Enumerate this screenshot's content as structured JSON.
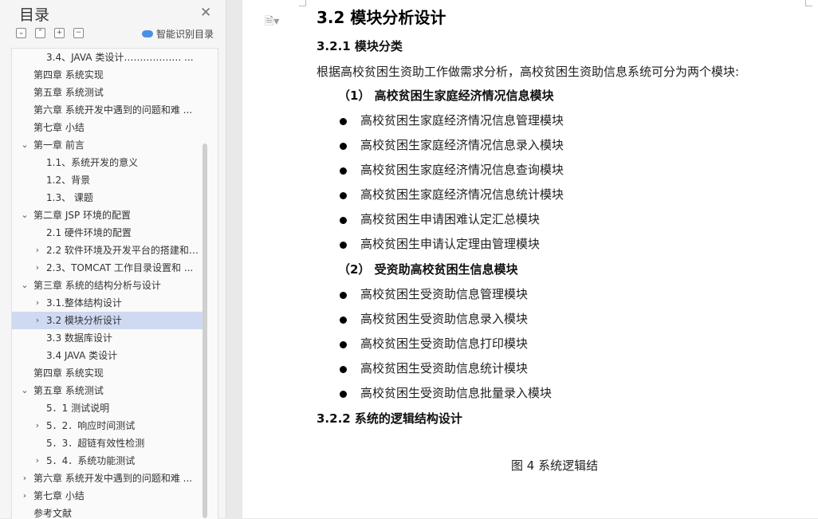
{
  "sidebar": {
    "title": "目录",
    "close_icon": "close-icon",
    "toolbar": [
      "collapse-all-icon",
      "expand-all-icon",
      "add-icon",
      "remove-icon"
    ],
    "smart_toc_label": "智能识别目录",
    "items": [
      {
        "label": "3.4、JAVA 类设计……………… ...",
        "level": 2,
        "chevron": ""
      },
      {
        "label": "第四章  系统实现",
        "level": 1,
        "chevron": ""
      },
      {
        "label": "第五章  系统测试",
        "level": 1,
        "chevron": ""
      },
      {
        "label": "第六章  系统开发中遇到的问题和难 ...",
        "level": 1,
        "chevron": ""
      },
      {
        "label": "第七章  小结",
        "level": 1,
        "chevron": ""
      },
      {
        "label": "第一章    前言",
        "level": 1,
        "chevron": "down"
      },
      {
        "label": "1.1、系统开发的意义",
        "level": 2,
        "chevron": ""
      },
      {
        "label": "1.2、背景",
        "level": 2,
        "chevron": ""
      },
      {
        "label": "1.3、  课题",
        "level": 2,
        "chevron": ""
      },
      {
        "label": "第二章    JSP 环境的配置",
        "level": 1,
        "chevron": "down"
      },
      {
        "label": "2.1 硬件环境的配置",
        "level": 2,
        "chevron": ""
      },
      {
        "label": "2.2 软件环境及开发平台的搭建和 ...",
        "level": 2,
        "chevron": "right"
      },
      {
        "label": "2.3、TOMCAT 工作目录设置和 ...",
        "level": 2,
        "chevron": "right"
      },
      {
        "label": "第三章  系统的结构分析与设计",
        "level": 1,
        "chevron": "down"
      },
      {
        "label": "3.1.整体结构设计",
        "level": 2,
        "chevron": "right"
      },
      {
        "label": "3.2  模块分析设计",
        "level": 2,
        "chevron": "right",
        "selected": true
      },
      {
        "label": "3.3 数据库设计",
        "level": 2,
        "chevron": ""
      },
      {
        "label": "3.4 JAVA 类设计",
        "level": 2,
        "chevron": ""
      },
      {
        "label": "第四章  系统实现",
        "level": 1,
        "chevron": ""
      },
      {
        "label": "第五章    系统测试",
        "level": 1,
        "chevron": "down"
      },
      {
        "label": "5．1  测试说明",
        "level": 2,
        "chevron": ""
      },
      {
        "label": "5．2．响应时间测试",
        "level": 2,
        "chevron": "right"
      },
      {
        "label": "5．3．超链有效性检测",
        "level": 2,
        "chevron": ""
      },
      {
        "label": "5．4．系统功能测试",
        "level": 2,
        "chevron": "right"
      },
      {
        "label": "第六章  系统开发中遇到的问题和难 ...",
        "level": 1,
        "chevron": "right"
      },
      {
        "label": "第七章  小结",
        "level": 1,
        "chevron": "right"
      },
      {
        "label": "参考文献",
        "level": 1,
        "chevron": ""
      }
    ]
  },
  "document": {
    "section_title": "3.2  模块分析设计",
    "subsection_1": "3.2.1 模块分类",
    "intro": "根据高校贫困生资助工作做需求分析，高校贫困生资助信息系统可分为两个模块:",
    "group_1_title": "（1）  高校贫困生家庭经济情况信息模块",
    "group_1_items": [
      "高校贫困生家庭经济情况信息管理模块",
      "高校贫困生家庭经济情况信息录入模块",
      "高校贫困生家庭经济情况信息查询模块",
      "高校贫困生家庭经济情况信息统计模块",
      "高校贫困生申请困难认定汇总模块",
      "高校贫困生申请认定理由管理模块"
    ],
    "group_2_title": "（2）  受资助高校贫困生信息模块",
    "group_2_items": [
      "高校贫困生受资助信息管理模块",
      "高校贫困生受资助信息录入模块",
      "高校贫困生受资助信息打印模块",
      "高校贫困生受资助信息统计模块",
      "高校贫困生受资助信息批量录入模块"
    ],
    "subsection_2": "3.2.2 系统的逻辑结构设计",
    "figure_caption": "图 4  系统逻辑结"
  }
}
